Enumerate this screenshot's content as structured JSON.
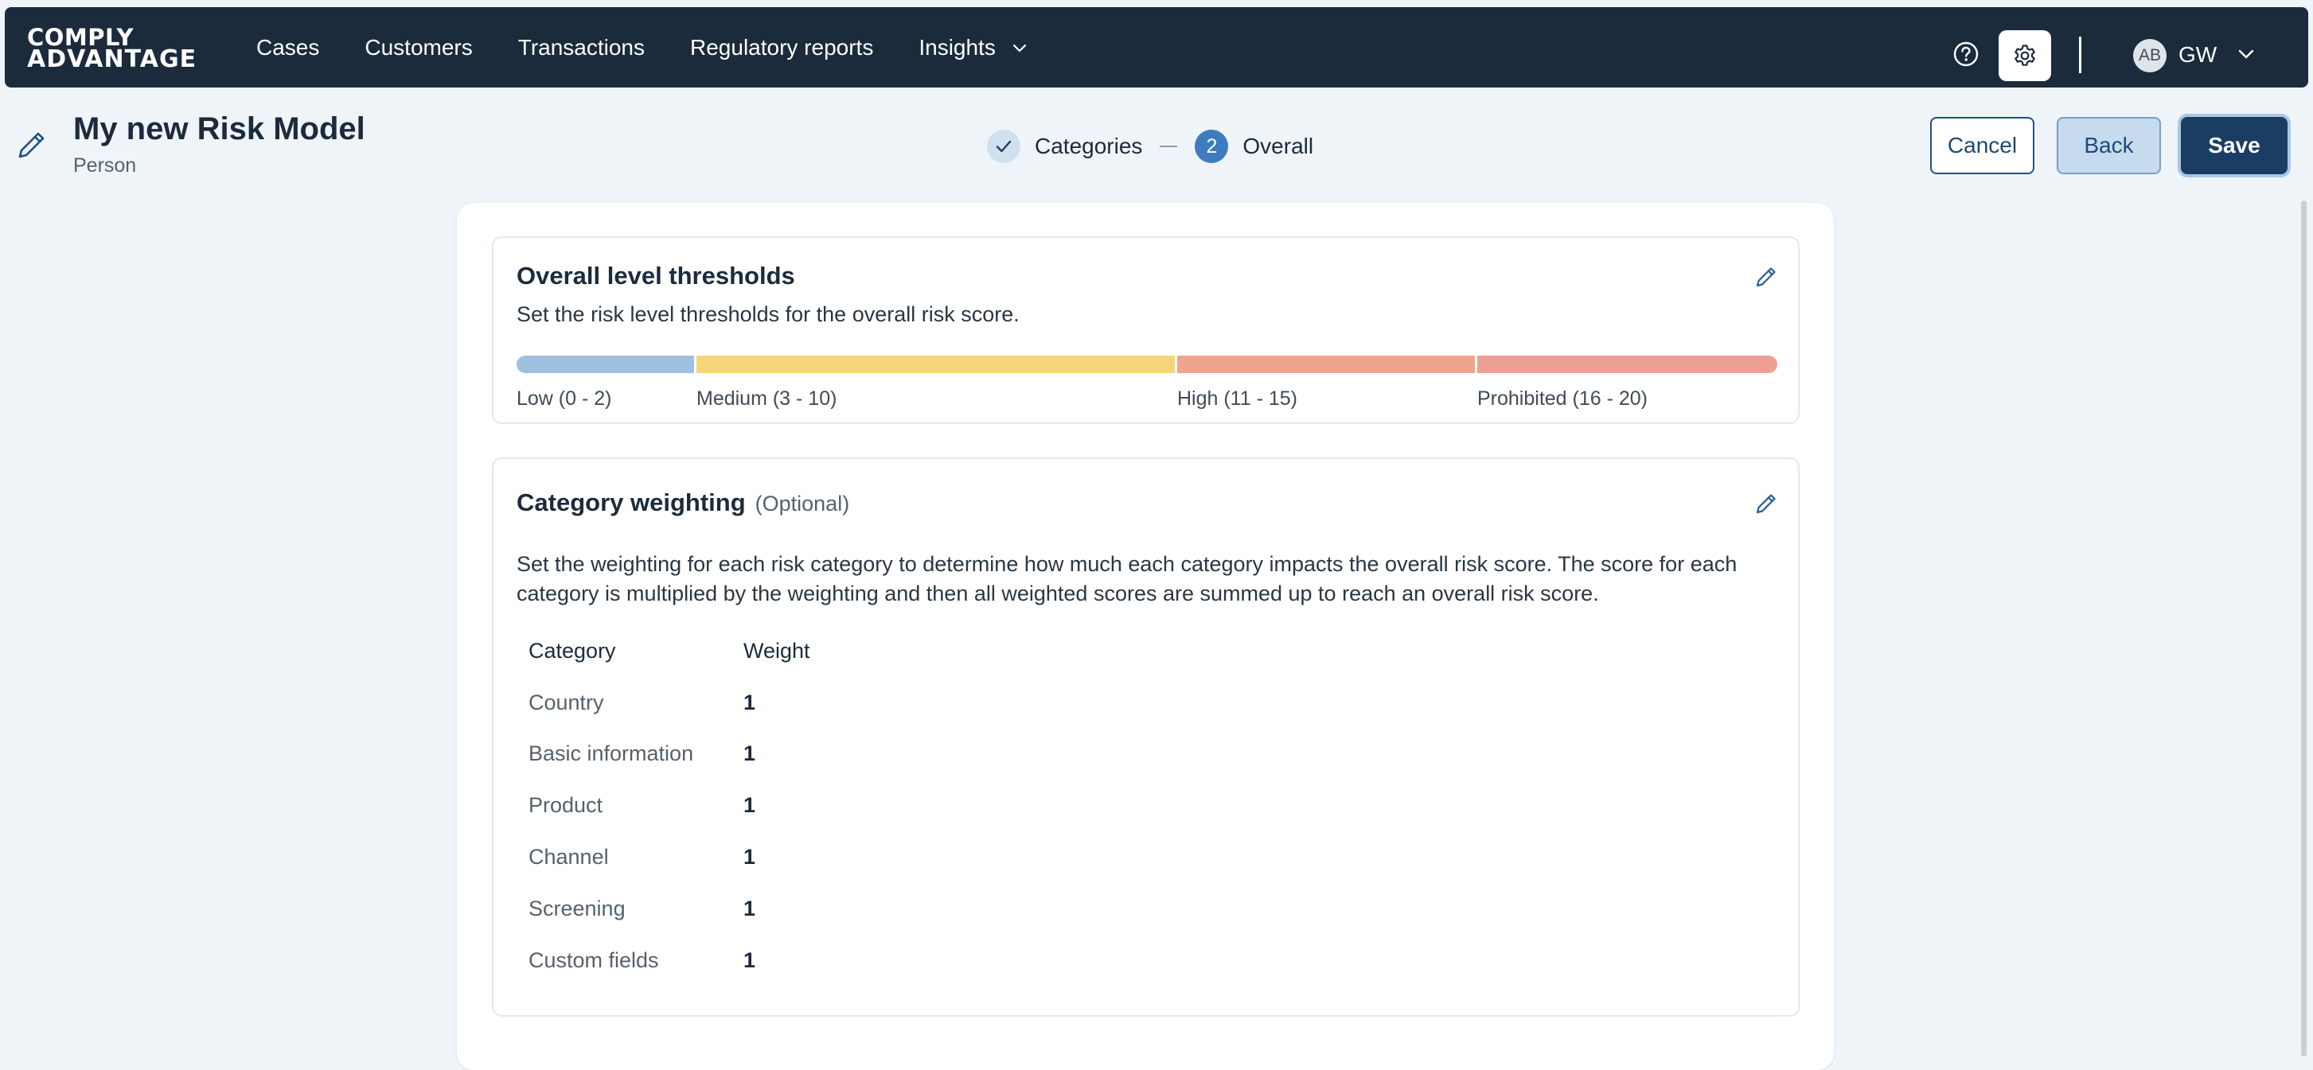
{
  "nav": {
    "logo_line1": "COMPLY",
    "logo_line2": "ADVANTAGE",
    "links": [
      {
        "label": "Cases"
      },
      {
        "label": "Customers"
      },
      {
        "label": "Transactions"
      },
      {
        "label": "Regulatory reports"
      },
      {
        "label": "Insights"
      }
    ],
    "user": {
      "avatar_initials": "AB",
      "initials": "GW"
    }
  },
  "header": {
    "title": "My new Risk Model",
    "subtitle": "Person",
    "steps": [
      {
        "label": "Categories",
        "state": "complete"
      },
      {
        "number": "2",
        "label": "Overall",
        "state": "current"
      }
    ],
    "buttons": {
      "cancel": "Cancel",
      "back": "Back",
      "save": "Save"
    }
  },
  "thresholds": {
    "title": "Overall level thresholds",
    "description": "Set the risk level thresholds for the overall risk score.",
    "max_score": 20,
    "levels": [
      {
        "label": "Low (0 - 2)",
        "from": 0,
        "to": 2,
        "color": "#9fc1de"
      },
      {
        "label": "Medium (3 - 10)",
        "from": 3,
        "to": 10,
        "color": "#f5d57a"
      },
      {
        "label": "High (11 - 15)",
        "from": 11,
        "to": 15,
        "color": "#eea58c"
      },
      {
        "label": "Prohibited (16 - 20)",
        "from": 16,
        "to": 20,
        "color": "#eea095"
      }
    ]
  },
  "weighting": {
    "title": "Category weighting",
    "optional": "(Optional)",
    "description_line1": "Set the weighting for each risk category to determine how much each category impacts the overall risk score. The score for each",
    "description_line2": "category is multiplied by the weighting and then all weighted scores are summed up to reach an overall risk score.",
    "columns": {
      "category": "Category",
      "weight": "Weight"
    },
    "rows": [
      {
        "category": "Country",
        "weight": "1"
      },
      {
        "category": "Basic information",
        "weight": "1"
      },
      {
        "category": "Product",
        "weight": "1"
      },
      {
        "category": "Channel",
        "weight": "1"
      },
      {
        "category": "Screening",
        "weight": "1"
      },
      {
        "category": "Custom fields",
        "weight": "1"
      }
    ]
  },
  "colors": {
    "nav_bg": "#1b2b3c",
    "accent": "#3e7cbf",
    "primary_button": "#1b3d63"
  }
}
